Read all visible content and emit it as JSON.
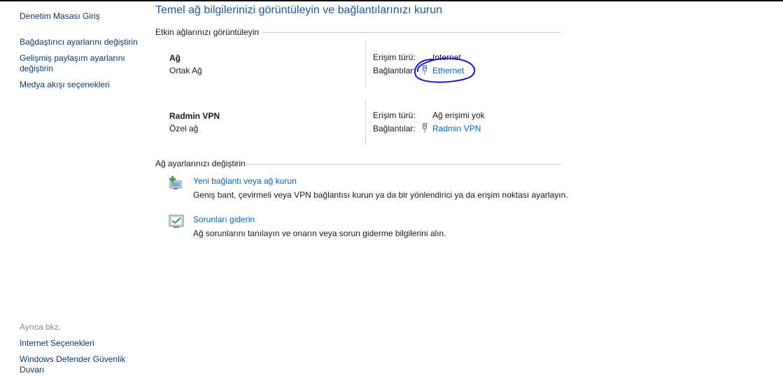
{
  "sidebar": {
    "home": "Denetim Masası Giriş",
    "items": [
      {
        "label": "Bağdaştırıcı ayarlarını değiştirin"
      },
      {
        "label_line1": "Gelişmiş paylaşım ayarlarını",
        "label_line2": "değiştirin"
      },
      {
        "label": "Medya akışı seçenekleri"
      }
    ],
    "see_also": {
      "heading": "Ayrıca bkz.",
      "items": [
        {
          "label": "Internet Seçenekleri"
        },
        {
          "label_line1": "Windows Defender Güvenlik",
          "label_line2": "Duvarı"
        }
      ]
    }
  },
  "main": {
    "title": "Temel ağ bilgilerinizi görüntüleyin ve bağlantılarınızı kurun",
    "active_section": "Etkin ağlarınızı görüntüleyin",
    "networks": [
      {
        "name": "Ağ",
        "type": "Ortak Ağ",
        "access_label": "Erişim türü:",
        "access_value": "Internet",
        "connections_label": "Bağlantılar:",
        "connection": "Ethernet"
      },
      {
        "name": "Radmin VPN",
        "type": "Özel ağ",
        "access_label": "Erişim türü:",
        "access_value": "Ağ erişimi yok",
        "connections_label": "Bağlantılar:",
        "connection": "Radmin VPN"
      }
    ],
    "change_section": "Ağ ayarlarınızı değiştirin",
    "tasks": [
      {
        "link": "Yeni bağlantı veya ağ kurun",
        "desc": "Geniş bant, çevirmeli veya VPN bağlantısı kurun ya da bir yönlendirici ya da erişim noktası ayarlayın.",
        "icon": "new-connection-icon"
      },
      {
        "link": "Sorunları giderin",
        "desc": "Ağ sorunlarını tanılayın ve onarın veya sorun giderme bilgilerini alın.",
        "icon": "troubleshoot-icon"
      }
    ]
  },
  "colors": {
    "link": "#0066cc",
    "title": "#1e5aa8",
    "annotation": "#1a1acc"
  }
}
